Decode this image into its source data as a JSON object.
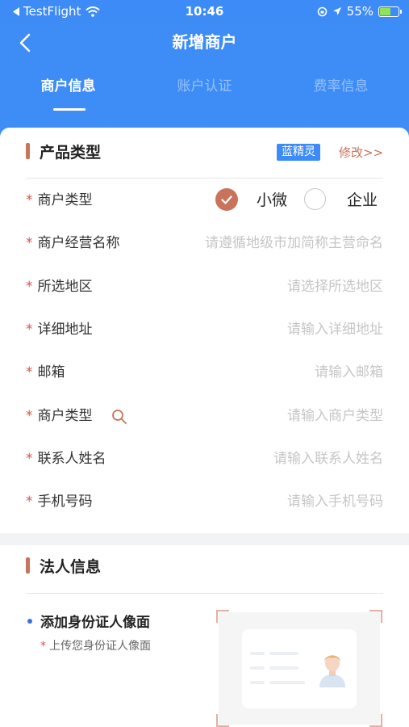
{
  "status": {
    "carrier": "TestFlight",
    "time": "10:46",
    "battery": "55%"
  },
  "nav": {
    "title": "新增商户"
  },
  "tabs": [
    {
      "label": "商户信息"
    },
    {
      "label": "账户认证"
    },
    {
      "label": "费率信息"
    }
  ],
  "product": {
    "section_title": "产品类型",
    "badge": "蓝精灵",
    "edit": "修改>>"
  },
  "form": {
    "merchant_type": {
      "label": "商户类型",
      "options": [
        "小微",
        "企业"
      ],
      "selected": "小微"
    },
    "business_name": {
      "label": "商户经营名称",
      "placeholder": "请遵循地级市加简称主营命名"
    },
    "region": {
      "label": "所选地区",
      "placeholder": "请选择所选地区"
    },
    "address": {
      "label": "详细地址",
      "placeholder": "请输入详细地址"
    },
    "email": {
      "label": "邮箱",
      "placeholder": "请输入邮箱"
    },
    "category": {
      "label": "商户类型",
      "placeholder": "请输入商户类型"
    },
    "contact_name": {
      "label": "联系人姓名",
      "placeholder": "请输入联系人姓名"
    },
    "phone": {
      "label": "手机号码",
      "placeholder": "请输入手机号码"
    }
  },
  "legal": {
    "section_title": "法人信息",
    "id_front_title": "添加身份证人像面",
    "id_front_hint": "上传您身份证人像面"
  },
  "required_mark": "*",
  "colors": {
    "primary": "#3d8bf6",
    "accent": "#c8735a",
    "required": "#d9534f"
  }
}
